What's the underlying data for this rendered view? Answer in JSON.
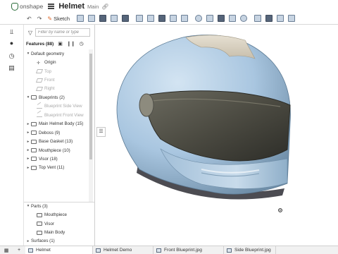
{
  "header": {
    "logo_text": "onshape",
    "doc_title": "Helmet",
    "branch": "Main"
  },
  "toolbar": {
    "undo_icon": "undo-icon",
    "redo_icon": "redo-icon",
    "sketch_label": "Sketch"
  },
  "feature_tree": {
    "filter_placeholder": "Filter by name or type",
    "header_title": "Features (88)",
    "items": [
      {
        "label": "Default geometry",
        "chev": "v",
        "icon": "none",
        "indent": 0,
        "dim": false
      },
      {
        "label": "Origin",
        "chev": "",
        "icon": "origin",
        "indent": 1,
        "dim": false
      },
      {
        "label": "Top",
        "chev": "",
        "icon": "plane",
        "indent": 1,
        "dim": true
      },
      {
        "label": "Front",
        "chev": "",
        "icon": "plane",
        "indent": 1,
        "dim": true
      },
      {
        "label": "Right",
        "chev": "",
        "icon": "plane",
        "indent": 1,
        "dim": true
      },
      {
        "label": "Blueprints (2)",
        "chev": "v",
        "icon": "folder",
        "indent": 0,
        "dim": false
      },
      {
        "label": "Blueprint Side View",
        "chev": "",
        "icon": "pencil",
        "indent": 1,
        "dim": true
      },
      {
        "label": "Blueprint Front View",
        "chev": "",
        "icon": "pencil",
        "indent": 1,
        "dim": true
      },
      {
        "label": "Main Helmet Body (15)",
        "chev": ">",
        "icon": "folder",
        "indent": 0,
        "dim": false
      },
      {
        "label": "Deboss (9)",
        "chev": ">",
        "icon": "folder",
        "indent": 0,
        "dim": false
      },
      {
        "label": "Base Gasket (13)",
        "chev": ">",
        "icon": "folder",
        "indent": 0,
        "dim": false
      },
      {
        "label": "Mouthpiece (10)",
        "chev": ">",
        "icon": "folder",
        "indent": 0,
        "dim": false
      },
      {
        "label": "Visor (18)",
        "chev": ">",
        "icon": "folder",
        "indent": 0,
        "dim": false
      },
      {
        "label": "Top Vent (11)",
        "chev": ">",
        "icon": "folder",
        "indent": 0,
        "dim": false
      }
    ]
  },
  "parts_list": {
    "items": [
      {
        "label": "Parts (3)",
        "chev": "v",
        "icon": "none",
        "indent": 0
      },
      {
        "label": "Mouthpiece",
        "chev": "",
        "icon": "part",
        "indent": 1
      },
      {
        "label": "Visor",
        "chev": "",
        "icon": "part",
        "indent": 1
      },
      {
        "label": "Main Body",
        "chev": "",
        "icon": "part",
        "indent": 1
      },
      {
        "label": "Surfaces (1)",
        "chev": ">",
        "icon": "none",
        "indent": 0
      }
    ]
  },
  "tabs": [
    {
      "label": "Helmet",
      "active": true
    },
    {
      "label": "Helmet Demo",
      "active": false
    },
    {
      "label": "Front Blueprint.jpg",
      "active": false
    },
    {
      "label": "Side Blueprint.jpg",
      "active": false
    }
  ],
  "colors": {
    "shell": "#a9c6e0",
    "visor": "#4c4b42",
    "top_vent": "#d9d2c2",
    "base_gasket": "#4c4c52"
  }
}
